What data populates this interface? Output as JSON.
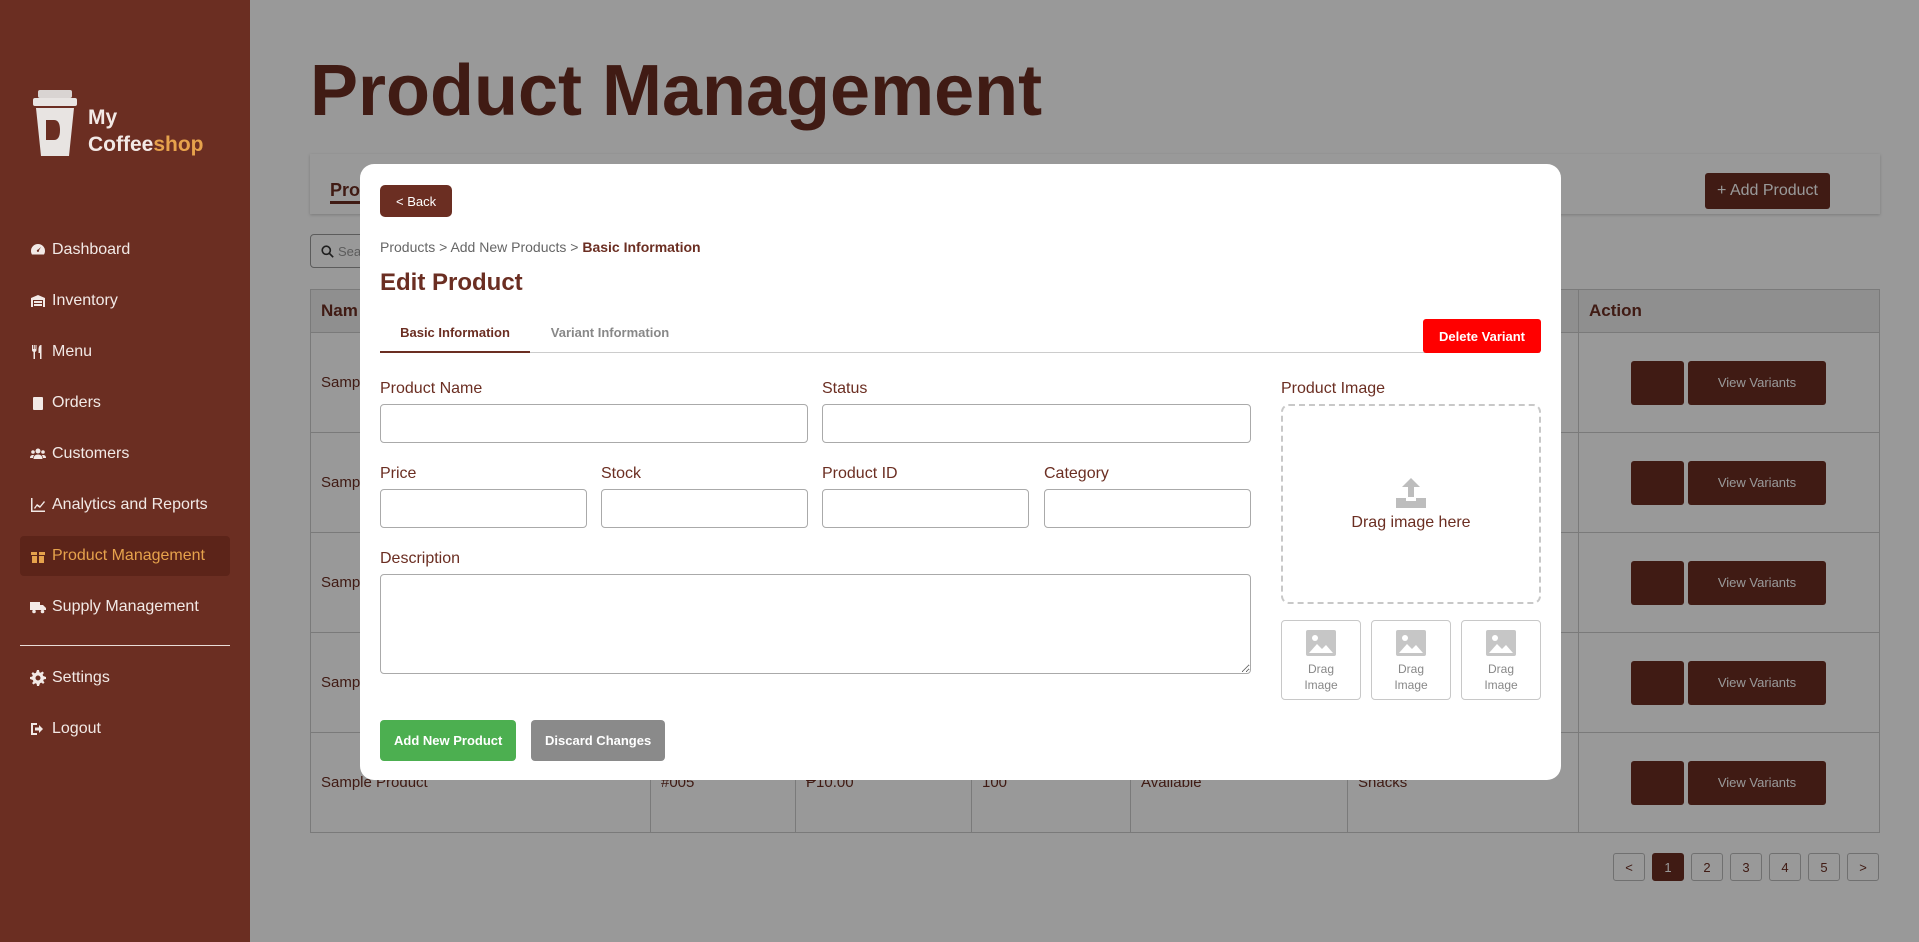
{
  "app": {
    "logo_line1": "My",
    "logo_line2a": "Coffee",
    "logo_line2b": "shop"
  },
  "sidebar": {
    "items": [
      {
        "label": "Dashboard",
        "icon": "dashboard-icon"
      },
      {
        "label": "Inventory",
        "icon": "warehouse-icon"
      },
      {
        "label": "Menu",
        "icon": "utensils-icon"
      },
      {
        "label": "Orders",
        "icon": "clipboard-icon"
      },
      {
        "label": "Customers",
        "icon": "users-icon"
      },
      {
        "label": "Analytics and Reports",
        "icon": "chart-line-icon"
      },
      {
        "label": "Product Management",
        "icon": "box-icon",
        "active": true
      },
      {
        "label": "Supply Management",
        "icon": "truck-icon"
      }
    ],
    "bottom": [
      {
        "label": "Settings",
        "icon": "gear-icon"
      },
      {
        "label": "Logout",
        "icon": "logout-icon"
      }
    ]
  },
  "page": {
    "title": "Product Management",
    "tab_label": "Pro",
    "add_product_label": "Add Product",
    "search_placeholder": "Sea",
    "table": {
      "col_name": "Nam",
      "col_action": "Action",
      "row_partial": "Samp",
      "last_row": [
        "Sample Product",
        "#005",
        "₱10.00",
        "100",
        "Available",
        "Snacks"
      ],
      "view_label": "View Variants"
    },
    "pager": [
      "<",
      "1",
      "2",
      "3",
      "4",
      "5",
      ">"
    ]
  },
  "modal": {
    "back_label": "< Back",
    "breadcrumb": {
      "p1": "Products",
      "sep": " > ",
      "p2": "Add New Products",
      "p3": "Basic Information"
    },
    "title": "Edit Product",
    "tab_basic": "Basic Information",
    "tab_variant": "Variant Information",
    "delete_label": "Delete Variant",
    "labels": {
      "product_name": "Product Name",
      "status": "Status",
      "price": "Price",
      "stock": "Stock",
      "product_id": "Product ID",
      "category": "Category",
      "description": "Description",
      "product_image": "Product Image"
    },
    "drag_main": "Drag image here",
    "drag_thumb": "Drag Image",
    "add_label": "Add New Product",
    "discard_label": "Discard Changes"
  },
  "colors": {
    "brand": "#6b2e22",
    "accent": "#e6a24c",
    "danger": "#ff0000",
    "success": "#4caf50"
  }
}
